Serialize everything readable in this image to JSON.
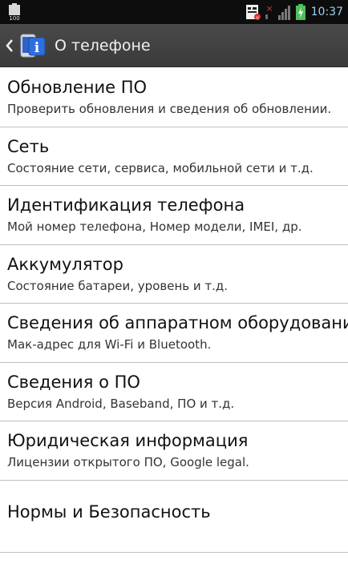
{
  "status_bar": {
    "battery_label": "100",
    "clock": "10:37",
    "icons": [
      "battery-icon",
      "notification-icon",
      "no-signal-icon",
      "signal-icon",
      "charging-battery-icon"
    ]
  },
  "action_bar": {
    "title": "О телефоне",
    "back_icon": "chevron-left-icon",
    "app_icon": "phone-info-icon"
  },
  "items": [
    {
      "title": "Обновление ПО",
      "subtitle": "Проверить обновления и сведения об обновлении."
    },
    {
      "title": "Сеть",
      "subtitle": "Состояние сети, сервиса, мобильной сети и т.д."
    },
    {
      "title": "Идентификация телефона",
      "subtitle": "Мой номер телефона, Номер модели, IMEI, др."
    },
    {
      "title": "Аккумулятор",
      "subtitle": "Состояние батареи, уровень и т.д."
    },
    {
      "title": "Сведения об аппаратном оборудовани",
      "subtitle": "Мак-адрес для Wi-Fi и Bluetooth."
    },
    {
      "title": "Сведения о ПО",
      "subtitle": "Версия Android, Baseband, ПО и т.д."
    },
    {
      "title": "Юридическая информация",
      "subtitle": "Лицензии открытого ПО, Google legal."
    },
    {
      "title": "Нормы и Безопасность",
      "subtitle": ""
    }
  ]
}
